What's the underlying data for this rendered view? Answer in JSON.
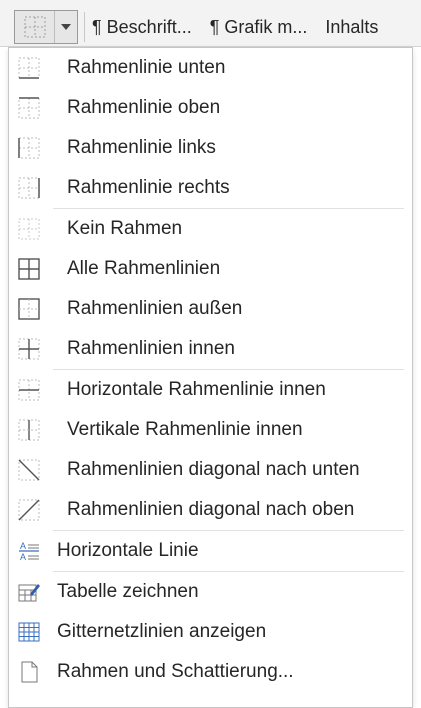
{
  "ribbon": {
    "styles": [
      "¶ Beschrift...",
      "¶ Grafik m...",
      "Inhalts"
    ]
  },
  "menu": {
    "items": [
      {
        "label": "Rahmenlinie unten",
        "icon": "border-bottom-icon"
      },
      {
        "label": "Rahmenlinie oben",
        "icon": "border-top-icon"
      },
      {
        "label": "Rahmenlinie links",
        "icon": "border-left-icon"
      },
      {
        "label": "Rahmenlinie rechts",
        "icon": "border-right-icon"
      },
      {
        "label": "Kein Rahmen",
        "icon": "no-border-icon"
      },
      {
        "label": "Alle Rahmenlinien",
        "icon": "all-borders-icon"
      },
      {
        "label": "Rahmenlinien außen",
        "icon": "outside-borders-icon"
      },
      {
        "label": "Rahmenlinien innen",
        "icon": "inside-borders-icon"
      },
      {
        "label": "Horizontale Rahmenlinie innen",
        "icon": "inside-horizontal-border-icon"
      },
      {
        "label": "Vertikale Rahmenlinie innen",
        "icon": "inside-vertical-border-icon"
      },
      {
        "label": "Rahmenlinien diagonal nach unten",
        "icon": "diagonal-down-border-icon"
      },
      {
        "label": "Rahmenlinien diagonal nach oben",
        "icon": "diagonal-up-border-icon"
      },
      {
        "label": "Horizontale Linie",
        "icon": "horizontal-line-icon"
      },
      {
        "label": "Tabelle zeichnen",
        "icon": "draw-table-icon"
      },
      {
        "label": "Gitternetzlinien anzeigen",
        "icon": "view-gridlines-icon"
      },
      {
        "label": "Rahmen und Schattierung...",
        "icon": "borders-and-shading-icon"
      }
    ]
  }
}
